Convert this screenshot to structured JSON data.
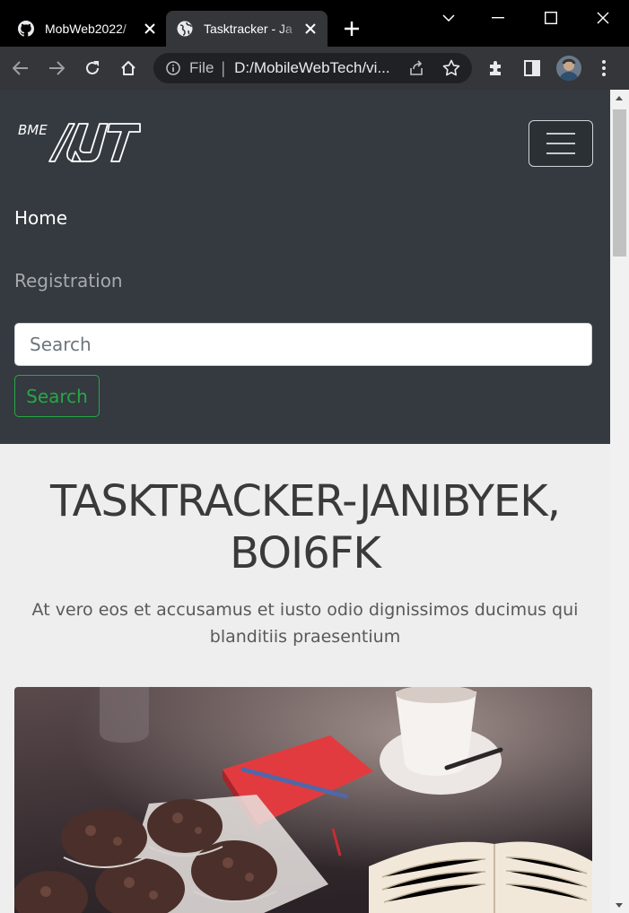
{
  "browser": {
    "tabs": [
      {
        "title": "MobWeb2022/",
        "icon": "github-icon",
        "active": false
      },
      {
        "title": "Tasktracker - Ja",
        "icon": "globe-icon",
        "active": true
      }
    ],
    "omnibox": {
      "scheme_label": "File",
      "url": "D:/MobileWebTech/vi..."
    }
  },
  "navbar": {
    "brand": "BME AUT",
    "links": [
      {
        "label": "Home",
        "active": true
      },
      {
        "label": "Registration",
        "active": false
      }
    ],
    "search": {
      "placeholder": "Search",
      "button_label": "Search"
    }
  },
  "hero": {
    "title": "TASKTRACKER-JANIBYEK, BOI6FK",
    "lead": "At vero eos et accusamus et iusto odio dignissimos ducimus qui blanditiis praesentium"
  },
  "colors": {
    "navbar_bg": "#343a40",
    "page_bg": "#eeeeee",
    "success": "#28a745"
  }
}
